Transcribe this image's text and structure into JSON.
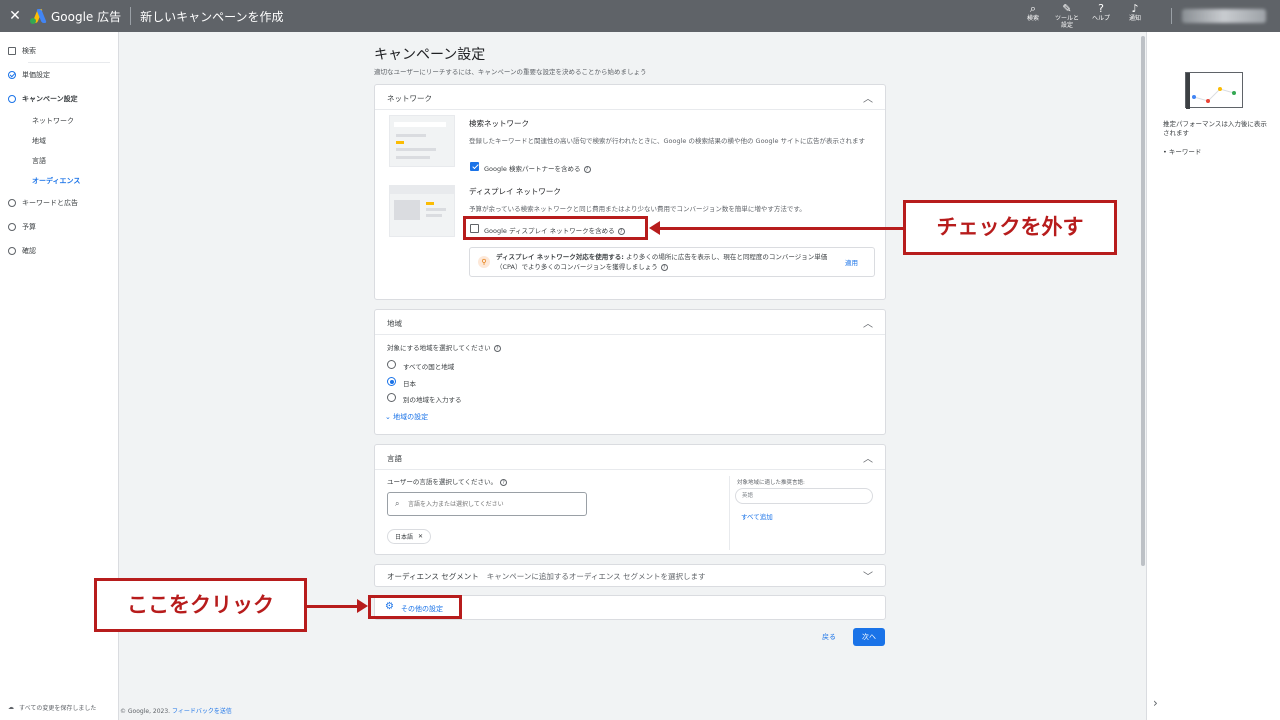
{
  "topbar": {
    "close_label": "✕",
    "brand": "Google 広告",
    "page_title": "新しいキャンペーンを作成",
    "icons": [
      {
        "icon": "search-icon",
        "glyph": "⌕",
        "label": "検索"
      },
      {
        "icon": "wrench-icon",
        "glyph": "✎",
        "label": "ツールと\n設定"
      },
      {
        "icon": "help-icon",
        "glyph": "?",
        "label": "ヘルプ"
      },
      {
        "icon": "bell-icon",
        "glyph": "♪",
        "label": "通知"
      }
    ]
  },
  "sidebar": {
    "items": [
      {
        "label": "検索"
      },
      {
        "label": "単価設定"
      },
      {
        "label": "キャンペーン設定"
      },
      {
        "label": "キーワードと広告"
      },
      {
        "label": "予算"
      },
      {
        "label": "確認"
      }
    ],
    "subitems": [
      "ネットワーク",
      "地域",
      "言語",
      "オーディエンス"
    ],
    "save_note": "すべての変更を保存しました"
  },
  "main": {
    "title": "キャンペーン設定",
    "subtitle": "適切なユーザーにリーチするには、キャンペーンの重要な設定を決めることから始めましょう"
  },
  "network": {
    "header": "ネットワーク",
    "search_title": "検索ネットワーク",
    "search_desc": "登録したキーワードと関連性の高い語句で検索が行われたときに、Google の検索結果の横や他の Google サイトに広告が表示されます",
    "search_partner_label": "Google 検索パートナーを含める",
    "display_title": "ディスプレイ ネットワーク",
    "display_desc": "予算が余っている検索ネットワークと同じ費用またはより少ない費用でコンバージョン数を簡単に増やす方法です。",
    "display_include_label": "Google ディスプレイ ネットワークを含める",
    "tip_bold": "ディスプレイ ネットワーク対応を使用する:",
    "tip_text": " より多くの場所に広告を表示し、現在と同程度のコンバージョン単価（CPA）でより多くのコンバージョンを獲得しましょう",
    "tip_apply": "適用"
  },
  "region": {
    "header": "地域",
    "prompt": "対象にする地域を選択してください",
    "options": [
      "すべての国と地域",
      "日本",
      "別の地域を入力する"
    ],
    "selected_index": 1,
    "settings_link": "地域の設定"
  },
  "language": {
    "header": "言語",
    "prompt": "ユーザーの言語を選択してください。",
    "search_placeholder": "言語を入力または選択してください",
    "chip": "日本語",
    "side_label": "対象地域に適した推奨言語:",
    "side_value": "英語",
    "add_all": "すべて追加"
  },
  "audience": {
    "header": "オーディエンス セグメント",
    "desc": "キャンペーンに追加するオーディエンス セグメントを選択します"
  },
  "other_settings": {
    "label": "その他の設定"
  },
  "actions": {
    "back": "戻る",
    "next": "次へ"
  },
  "right_panel": {
    "text": "推定パフォーマンスは入力後に表示されます",
    "bullet": "キーワード"
  },
  "footer": {
    "copyright": "© Google, 2023.",
    "feedback": "フィードバックを送信"
  },
  "annotations": {
    "uncheck": "チェックを外す",
    "click_here": "ここをクリック",
    "color": "#b71c1c"
  }
}
